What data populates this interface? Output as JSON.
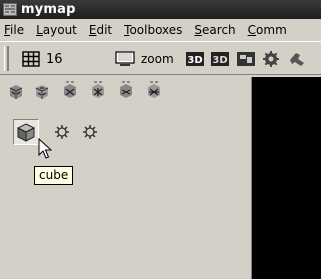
{
  "window": {
    "title": "mymap"
  },
  "menu": {
    "items": [
      {
        "underline": "F",
        "rest": "ile"
      },
      {
        "underline": "L",
        "rest": "ayout"
      },
      {
        "underline": "E",
        "rest": "dit"
      },
      {
        "underline": "T",
        "rest": "oolboxes"
      },
      {
        "underline": "S",
        "rest": "earch"
      },
      {
        "underline": "C",
        "rest": "omm"
      }
    ]
  },
  "toolbar": {
    "grid_value": "16",
    "zoom_label": "zoom"
  },
  "tooltip": {
    "text": "cube"
  },
  "icons": {
    "app": "map-icon",
    "grid": "grid-icon",
    "zoom": "screen-icon",
    "cube": "cube-icon",
    "cursor": "arrow-cursor-icon"
  },
  "colors": {
    "chrome": "#d4d0c8",
    "titlebar": "#2a2a2a",
    "tooltip_bg": "#ffffe1",
    "canvas": "#000000"
  }
}
